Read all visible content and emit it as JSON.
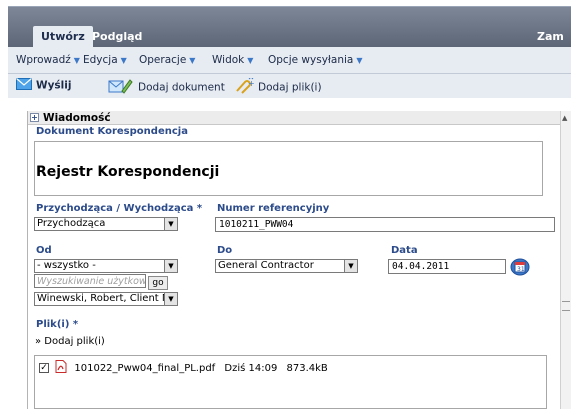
{
  "tabs": {
    "create": "Utwórz",
    "preview": "Podgląd",
    "close_partial": "Zam"
  },
  "menu": {
    "insert": "Wprowadź",
    "edit": "Edycja",
    "operations": "Operacje",
    "view": "Widok",
    "send_options": "Opcje wysyłania"
  },
  "toolbar": {
    "send": "Wyślij",
    "add_document": "Dodaj dokument",
    "add_files": "Dodaj plik(i)"
  },
  "panel": {
    "header": "Wiadomość",
    "section": "Dokument Korespondencja",
    "title": "Rejestr Korespondencji"
  },
  "form": {
    "direction_label": "Przychodząca / Wychodząca *",
    "direction_value": "Przychodząca",
    "reference_label": "Numer referencyjny",
    "reference_value": "1010211_PWW04",
    "from_label": "Od",
    "from_value": "- wszystko -",
    "search_placeholder": "Wyszukiwanie użytkowni",
    "go_label": "go",
    "from_user_value": "Winewski, Robert, Client M",
    "to_label": "Do",
    "to_value": "General Contractor",
    "date_label": "Data",
    "date_value": "04.04.2011",
    "files_label": "Plik(i) *",
    "add_files_link": "» Dodaj plik(i)"
  },
  "files": [
    {
      "name": "101022_Pww04_final_PL.pdf",
      "date": "Dziś 14:09",
      "size": "873.4kB",
      "checked": true
    }
  ],
  "colors": {
    "label_blue": "#2c4b8a",
    "ribbon": "#e7ebf2",
    "tabbar": "#5d6677",
    "accent": "#3c78c8"
  }
}
